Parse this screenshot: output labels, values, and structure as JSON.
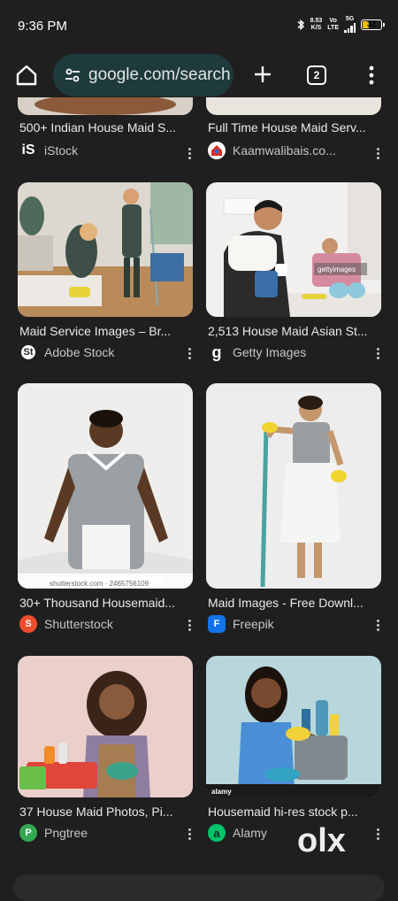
{
  "status_bar": {
    "time": "9:36 PM",
    "net_speed": "8.53",
    "net_unit": "K/S",
    "volte_top": "Vo",
    "volte_bottom": "LTE",
    "network_type": "5G",
    "battery": "32"
  },
  "toolbar": {
    "url": "google.com/search",
    "tab_count": "2"
  },
  "results": [
    {
      "title": "500+ Indian House Maid S...",
      "source": "iStock",
      "favicon_text": "iS",
      "favicon_bg": "#1f1f1f",
      "favicon_fg": "#ffffff"
    },
    {
      "title": "Full Time House Maid Serv...",
      "source": "Kaamwalibais.co...",
      "favicon_text": "",
      "favicon_bg": "#ffffff",
      "favicon_fg": "#d93025"
    },
    {
      "title": "Maid Service Images – Br...",
      "source": "Adobe Stock",
      "favicon_text": "St",
      "favicon_bg": "#ffffff",
      "favicon_fg": "#1f1f1f"
    },
    {
      "title": "2,513 House Maid Asian St...",
      "source": "Getty Images",
      "favicon_text": "g",
      "favicon_bg": "#1f1f1f",
      "favicon_fg": "#ffffff"
    },
    {
      "title": "30+ Thousand Housemaid...",
      "source": "Shutterstock",
      "favicon_text": "S",
      "favicon_bg": "#ee4c2c",
      "favicon_fg": "#ffffff"
    },
    {
      "title": "Maid Images - Free Downl...",
      "source": "Freepik",
      "favicon_text": "F",
      "favicon_bg": "#1273eb",
      "favicon_fg": "#ffffff"
    },
    {
      "title": "37 House Maid Photos, Pi...",
      "source": "Pngtree",
      "favicon_text": "P",
      "favicon_bg": "#34a853",
      "favicon_fg": "#ffffff"
    },
    {
      "title": "Housemaid hi-res stock p...",
      "source": "Alamy",
      "favicon_text": "a",
      "favicon_bg": "#00c26a",
      "favicon_fg": "#1f1f1f"
    }
  ],
  "image_captions": {
    "getty": "gettyimages",
    "shutterstock": "shutterstock.com · 2465756109",
    "alamy": "alamy"
  },
  "watermark": "olx",
  "colors": {
    "background": "#1f1f1f",
    "omnibox": "#1e3a3c",
    "battery": "#f2c200",
    "text": "#e8eaed"
  }
}
